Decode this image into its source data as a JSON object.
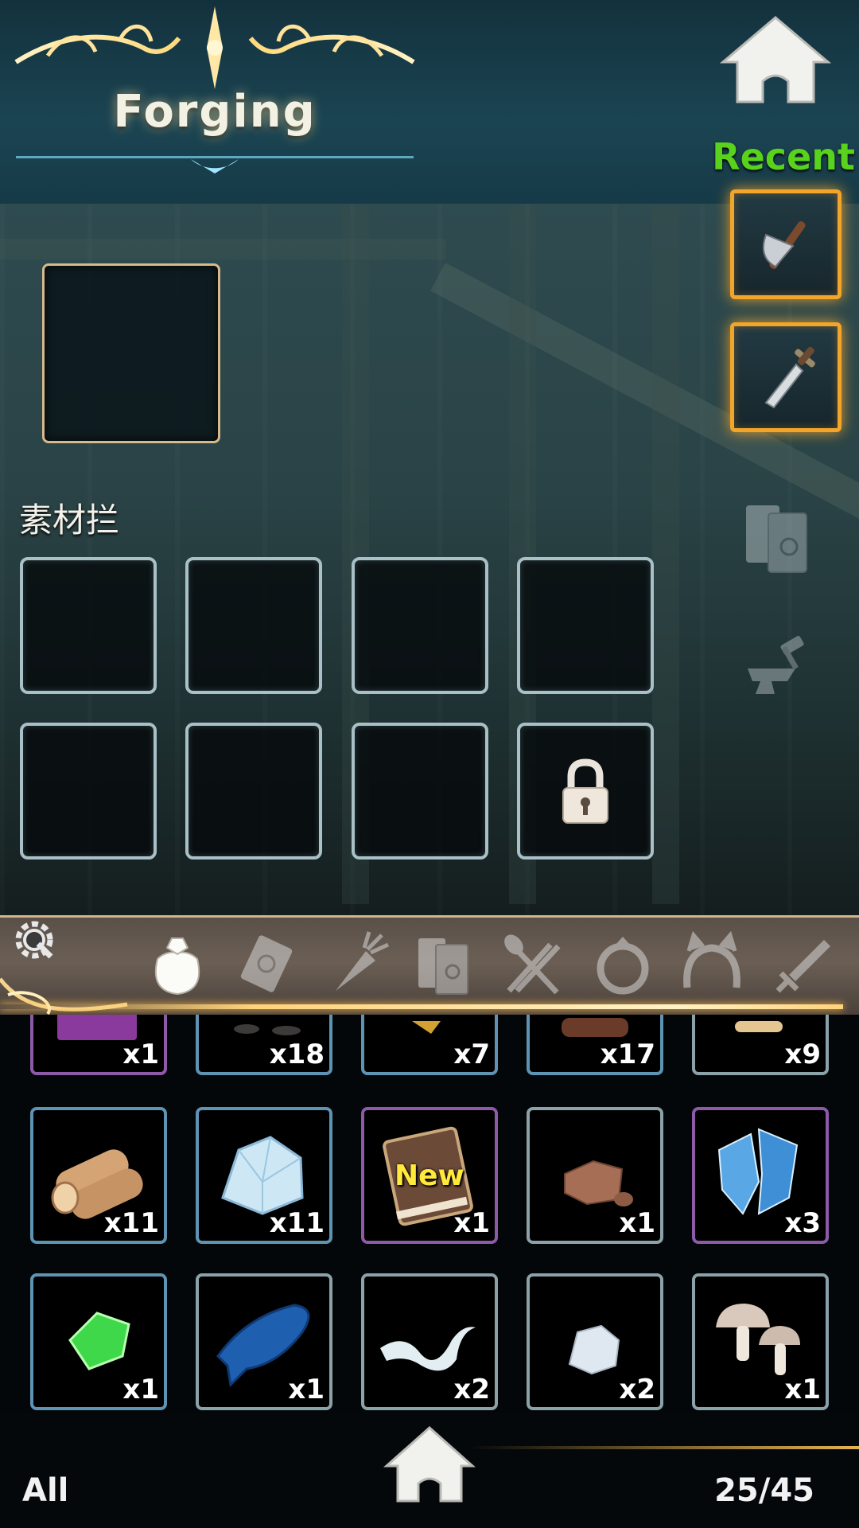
{
  "header": {
    "title": "Forging"
  },
  "recent": {
    "label": "Recent",
    "items": [
      {
        "icon": "axe-icon"
      },
      {
        "icon": "dagger-icon"
      }
    ]
  },
  "materials": {
    "label": "素材拦",
    "slots": [
      {
        "state": "empty"
      },
      {
        "state": "empty"
      },
      {
        "state": "empty"
      },
      {
        "state": "empty"
      },
      {
        "state": "empty"
      },
      {
        "state": "empty"
      },
      {
        "state": "empty"
      },
      {
        "state": "locked"
      }
    ]
  },
  "tabs": [
    {
      "icon": "bag-icon",
      "active": true
    },
    {
      "icon": "scroll-icon",
      "active": false
    },
    {
      "icon": "carrot-icon",
      "active": false
    },
    {
      "icon": "books-icon",
      "active": false
    },
    {
      "icon": "utensils-icon",
      "active": false
    },
    {
      "icon": "ring-icon",
      "active": false
    },
    {
      "icon": "headband-icon",
      "active": false
    },
    {
      "icon": "sword-icon",
      "active": false
    }
  ],
  "inventory": {
    "rows": [
      [
        {
          "item": "purple-book",
          "count": "x1",
          "rarity": "purple"
        },
        {
          "item": "dark-ore",
          "count": "x18",
          "rarity": "blue"
        },
        {
          "item": "gold-shard",
          "count": "x7",
          "rarity": "blue"
        },
        {
          "item": "log",
          "count": "x17",
          "rarity": "blue"
        },
        {
          "item": "bone",
          "count": "x9",
          "rarity": "grey"
        }
      ],
      [
        {
          "item": "wood-logs",
          "count": "x11",
          "rarity": "blue"
        },
        {
          "item": "ice-crystal",
          "count": "x11",
          "rarity": "blue"
        },
        {
          "item": "brown-book",
          "count": "x1",
          "rarity": "purple",
          "badge": "New"
        },
        {
          "item": "copper-ore",
          "count": "x1",
          "rarity": "grey"
        },
        {
          "item": "blue-crystal-cluster",
          "count": "x3",
          "rarity": "purple"
        }
      ],
      [
        {
          "item": "green-gem",
          "count": "x1",
          "rarity": "blue"
        },
        {
          "item": "blue-claw",
          "count": "x1",
          "rarity": "grey"
        },
        {
          "item": "white-cloth",
          "count": "x2",
          "rarity": "grey"
        },
        {
          "item": "white-stone",
          "count": "x2",
          "rarity": "grey"
        },
        {
          "item": "mushrooms",
          "count": "x1",
          "rarity": "grey"
        }
      ]
    ]
  },
  "footer": {
    "filter": "All",
    "capacity": "25/45"
  },
  "colors": {
    "recent": "#58d21c",
    "slot_glow": "#f2a52a",
    "new_badge": "#ffe93a"
  }
}
